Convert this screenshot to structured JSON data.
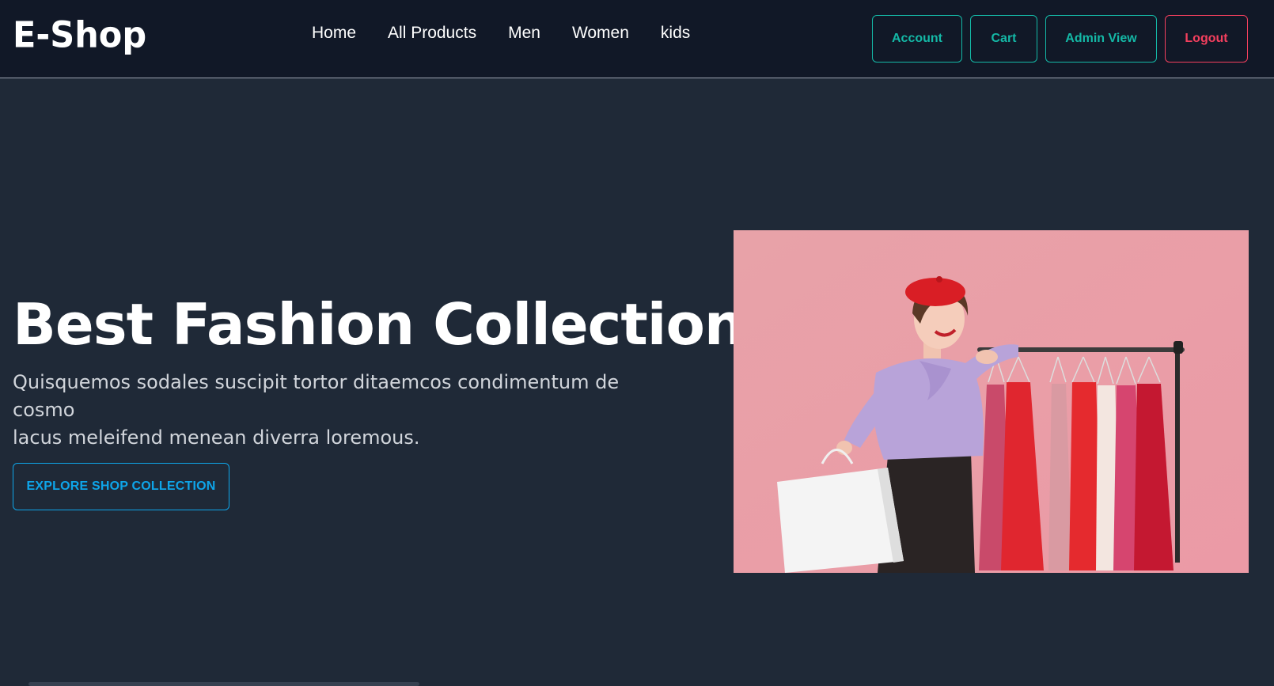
{
  "header": {
    "logo": "E-Shop",
    "nav": [
      "Home",
      "All Products",
      "Men",
      "Women",
      "kids"
    ],
    "buttons": {
      "account": "Account",
      "cart": "Cart",
      "admin": "Admin View",
      "logout": "Logout"
    }
  },
  "hero": {
    "title": "Best Fashion Collection",
    "description_line1": "Quisquemos sodales suscipit tortor ditaemcos condimentum de cosmo",
    "description_line2": "lacus meleifend menean diverra loremous.",
    "cta": "EXPLORE SHOP COLLECTION"
  },
  "colors": {
    "background": "#1f2937",
    "navbar": "#111827",
    "accent_teal": "#14b8a6",
    "accent_red": "#f43f5e",
    "accent_blue": "#0ea5e9"
  },
  "images": {
    "hero": "woman-shopping-with-clothes-rack"
  }
}
